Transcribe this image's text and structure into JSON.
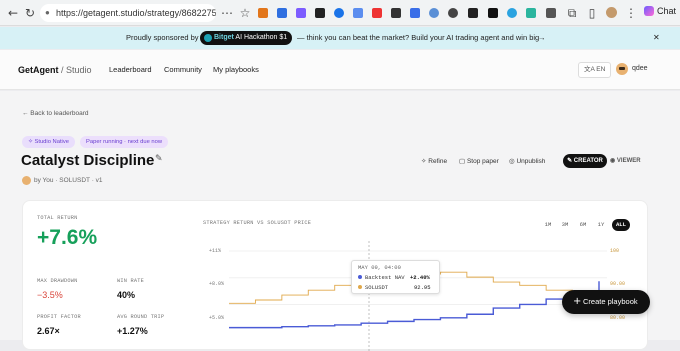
{
  "browser": {
    "url": "https://getagent.studio/strategy/86822755-aa...",
    "chat_label": "Chat"
  },
  "banner": {
    "prefix": "Proudly sponsored by",
    "brand": "Bitget",
    "event": "AI Hackathon $1",
    "tagline": "— think you can beat the market? Build your AI trading agent and win big",
    "arrow": "→",
    "close": "✕"
  },
  "header": {
    "brand": "GetAgent",
    "brand_suffix": "/ Studio",
    "nav": [
      "Leaderboard",
      "Community",
      "My playbooks"
    ],
    "language": "EN",
    "user": "qdee"
  },
  "page": {
    "back_link": "← Back to leaderboard",
    "badges": [
      "Studio Native",
      "Paper running · next due now"
    ],
    "title": "Catalyst Discipline",
    "byline": "by You · SOLUSDT · v1",
    "actions": [
      "Refine",
      "Stop paper",
      "Unpublish"
    ],
    "mode_creator": "CREATOR",
    "mode_viewer": "VIEWER"
  },
  "stats": {
    "total_return_label": "TOTAL RETURN",
    "total_return": "+7.6%",
    "max_drawdown_label": "MAX DRAWDOWN",
    "max_drawdown": "−3.5%",
    "win_rate_label": "WIN RATE",
    "win_rate": "40%",
    "profit_factor_label": "PROFIT FACTOR",
    "profit_factor": "2.67×",
    "avg_round_trip_label": "AVG ROUND TRIP",
    "avg_round_trip": "+1.27%"
  },
  "chart": {
    "title": "STRATEGY RETURN VS SOLUSDT PRICE",
    "ranges": [
      "1M",
      "3M",
      "6M",
      "1Y",
      "ALL"
    ],
    "active_range": "ALL",
    "left_ticks": [
      "+11%",
      "+8.0%",
      "+5.0%"
    ],
    "right_ticks": [
      "100",
      "90.00",
      "80.00"
    ],
    "tooltip": {
      "date": "MAY 09, 04:00",
      "nav_label": "Backtest NAV",
      "nav_value": "+2.40%",
      "price_label": "SOLUSDT",
      "price_value": "92.95"
    }
  },
  "chart_data": {
    "type": "line",
    "title": "STRATEGY RETURN VS SOLUSDT PRICE",
    "series": [
      {
        "name": "Backtest NAV",
        "axis": "left",
        "unit": "%",
        "color": "#4a5bd6",
        "values": [
          2.4,
          2.4,
          2.5,
          2.6,
          2.7,
          2.9,
          3.1,
          3.3,
          3.5,
          3.9,
          4.6,
          5.0,
          5.6,
          6.4,
          7.6
        ]
      },
      {
        "name": "SOLUSDT",
        "axis": "right",
        "color": "#e0a84a",
        "values": [
          84.0,
          85.0,
          86.5,
          88.0,
          89.5,
          91.0,
          92.0,
          92.95,
          93.5,
          92.0,
          90.5,
          89.5,
          88.0,
          86.5,
          85.5
        ]
      }
    ],
    "left_ylim": [
      0,
      11
    ],
    "right_ylim": [
      70,
      100
    ]
  },
  "fab": {
    "label": "Create playbook",
    "icon": "+"
  },
  "colors": {
    "accent_green": "#16a05a",
    "negative_red": "#d9453a",
    "purple": "#6a3fd0",
    "nav_blue": "#4a5bd6",
    "price_gold": "#e0a84a"
  }
}
